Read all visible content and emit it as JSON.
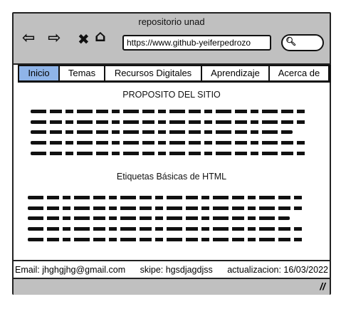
{
  "window": {
    "title": "repositorio unad"
  },
  "toolbar": {
    "back_icon": "back-arrow-icon",
    "forward_icon": "forward-arrow-icon",
    "stop_icon": "close-icon",
    "home_icon": "home-icon",
    "url": "https://www.github-yeiferpedrozo",
    "search_icon": "search-icon"
  },
  "tabs": [
    {
      "label": "Inicio",
      "active": true
    },
    {
      "label": "Temas"
    },
    {
      "label": "Recursos Digitales"
    },
    {
      "label": "Aprendizaje"
    },
    {
      "label": "Acerca de"
    }
  ],
  "content": {
    "section1_title": "PROPOSITO DEL SITIO",
    "section2_title": "Etiquetas Básicas de HTML"
  },
  "footer": {
    "email": "Email: jhghgjhg@gmail.com",
    "skype": "skipe: hgsdjagdjss",
    "updated": "actualizacion: 16/03/2022"
  },
  "colors": {
    "chrome": "#c0c0c0",
    "active_tab": "#8fb4e8"
  }
}
